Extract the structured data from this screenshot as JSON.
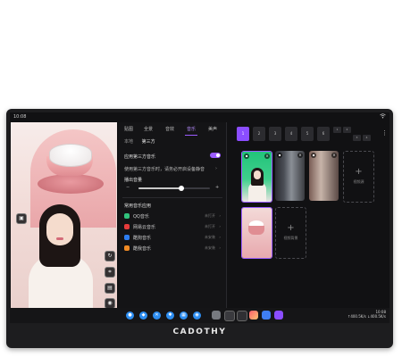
{
  "brand": "CADOTHY",
  "status_bar": {
    "time": "10:08",
    "wifi_icon": "wifi-icon"
  },
  "settings": {
    "tabs": [
      "贴图",
      "全景",
      "音效",
      "音乐",
      "美声"
    ],
    "active_tab": "音乐",
    "subtabs": [
      "本地",
      "第三方"
    ],
    "active_subtab": "第三方",
    "apply_music_label": "应用第三方音乐",
    "apply_music_enabled": true,
    "hint_text": "使用第三方音乐时，请务必开启设备静音",
    "volume_label": "播出音量",
    "volume_level": 0.6,
    "common_apps_label": "常用音乐应用",
    "apps": [
      {
        "name": "QQ音乐",
        "status": "未打开",
        "color": "#31c27c"
      },
      {
        "name": "网易云音乐",
        "status": "未打开",
        "color": "#e63b3b"
      },
      {
        "name": "酷狗音乐",
        "status": "未安装",
        "color": "#2d7df0"
      },
      {
        "name": "酷我音乐",
        "status": "未安装",
        "color": "#f08a24"
      }
    ]
  },
  "scenes": {
    "slots": [
      "1",
      "2",
      "3",
      "4",
      "5",
      "6"
    ],
    "active_slot": "1",
    "mini_grid": [
      "1",
      "2",
      "3",
      "4"
    ],
    "add_video_label": "视频源",
    "add_bg_label": "视频背景"
  },
  "dock": {
    "network_up": "400.5K/s",
    "network_down": "400.5K/s",
    "time": "10:08"
  },
  "colors": {
    "accent": "#9b5cff",
    "dock_blue": "#2d8df0"
  }
}
